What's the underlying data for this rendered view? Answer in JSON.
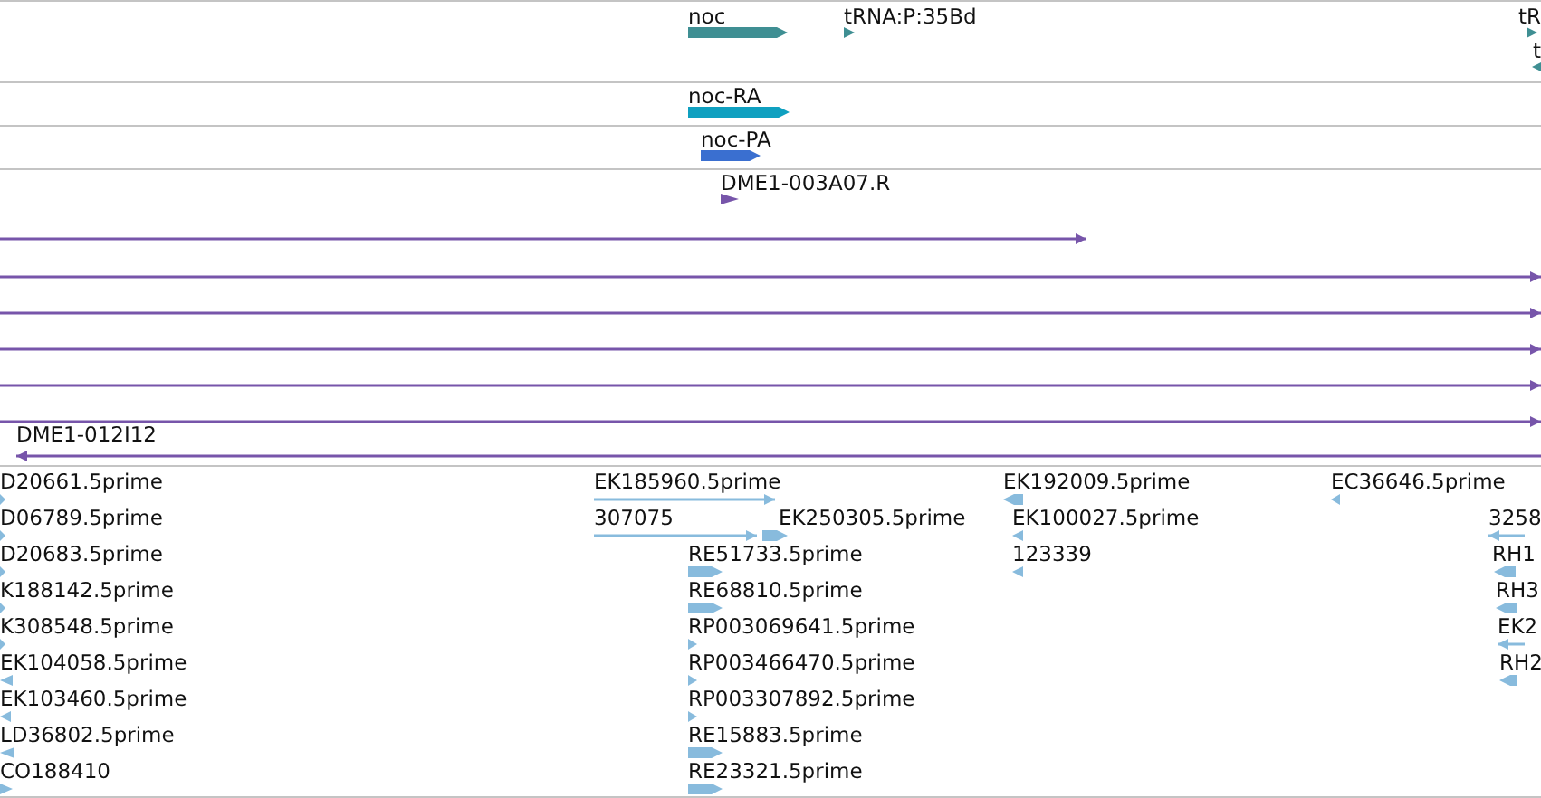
{
  "tracks": [
    {
      "kind": "gene",
      "color": "#3f8f93",
      "features": [
        {
          "label": "noc",
          "reverse": false,
          "kind": "bar"
        },
        {
          "label": "tRNA:P:35Bd",
          "reverse": false,
          "kind": "arrow"
        },
        {
          "label": "tR",
          "reverse": false,
          "kind": "arrow"
        },
        {
          "label": "t",
          "reverse": true,
          "kind": "arrow"
        }
      ]
    },
    {
      "kind": "transcript",
      "color": "#0fa0c0",
      "features": [
        {
          "label": "noc-RA",
          "reverse": false,
          "kind": "bar"
        }
      ]
    },
    {
      "kind": "protein",
      "color": "#3a6fd0",
      "features": [
        {
          "label": "noc-PA",
          "reverse": false,
          "kind": "bar"
        }
      ]
    },
    {
      "kind": "alignment",
      "color": "#7755aa",
      "features": [
        {
          "label": "DME1-003A07.R",
          "reverse": false,
          "kind": "arrow"
        },
        {
          "reverse": false,
          "kind": "line"
        },
        {
          "reverse": false,
          "kind": "line"
        },
        {
          "reverse": false,
          "kind": "line"
        },
        {
          "reverse": false,
          "kind": "line"
        },
        {
          "reverse": false,
          "kind": "line"
        },
        {
          "reverse": false,
          "kind": "line"
        },
        {
          "label": "DME1-012I12",
          "reverse": true,
          "kind": "line"
        }
      ]
    },
    {
      "kind": "est",
      "color": "#88bbdd",
      "features": [
        {
          "label": "D20661.5prime",
          "reverse": false,
          "kind": "arrow"
        },
        {
          "label": "D06789.5prime",
          "reverse": false,
          "kind": "arrow"
        },
        {
          "label": "D20683.5prime",
          "reverse": false,
          "kind": "arrow"
        },
        {
          "label": "K188142.5prime",
          "reverse": false,
          "kind": "arrow"
        },
        {
          "label": "K308548.5prime",
          "reverse": false,
          "kind": "arrow"
        },
        {
          "label": "EK104058.5prime",
          "reverse": true,
          "kind": "arrow"
        },
        {
          "label": "EK103460.5prime",
          "reverse": true,
          "kind": "arrow"
        },
        {
          "label": "LD36802.5prime",
          "reverse": true,
          "kind": "arrow"
        },
        {
          "label": "CO188410",
          "reverse": false,
          "kind": "arrow"
        },
        {
          "label": "EK185960.5prime",
          "reverse": false,
          "kind": "line"
        },
        {
          "label": "307075",
          "reverse": false,
          "kind": "line"
        },
        {
          "label": "EK250305.5prime",
          "reverse": false,
          "kind": "bar"
        },
        {
          "label": "RE51733.5prime",
          "reverse": false,
          "kind": "bar"
        },
        {
          "label": "RE68810.5prime",
          "reverse": false,
          "kind": "bar"
        },
        {
          "label": "RP003069641.5prime",
          "reverse": false,
          "kind": "arrow"
        },
        {
          "label": "RP003466470.5prime",
          "reverse": false,
          "kind": "arrow"
        },
        {
          "label": "RP003307892.5prime",
          "reverse": false,
          "kind": "arrow"
        },
        {
          "label": "RE15883.5prime",
          "reverse": false,
          "kind": "bar"
        },
        {
          "label": "RE23321.5prime",
          "reverse": false,
          "kind": "bar"
        },
        {
          "label": "EK192009.5prime",
          "reverse": true,
          "kind": "bar"
        },
        {
          "label": "EK100027.5prime",
          "reverse": true,
          "kind": "arrow"
        },
        {
          "label": "123339",
          "reverse": true,
          "kind": "arrow"
        },
        {
          "label": "EC36646.5prime",
          "reverse": true,
          "kind": "arrow"
        },
        {
          "label": "3258",
          "reverse": true,
          "kind": "line"
        },
        {
          "label": "RH1",
          "reverse": true,
          "kind": "bar"
        },
        {
          "label": "RH3",
          "reverse": true,
          "kind": "bar"
        },
        {
          "label": "EK2",
          "reverse": true,
          "kind": "line"
        },
        {
          "label": "RH2",
          "reverse": true,
          "kind": "bar"
        }
      ]
    }
  ]
}
